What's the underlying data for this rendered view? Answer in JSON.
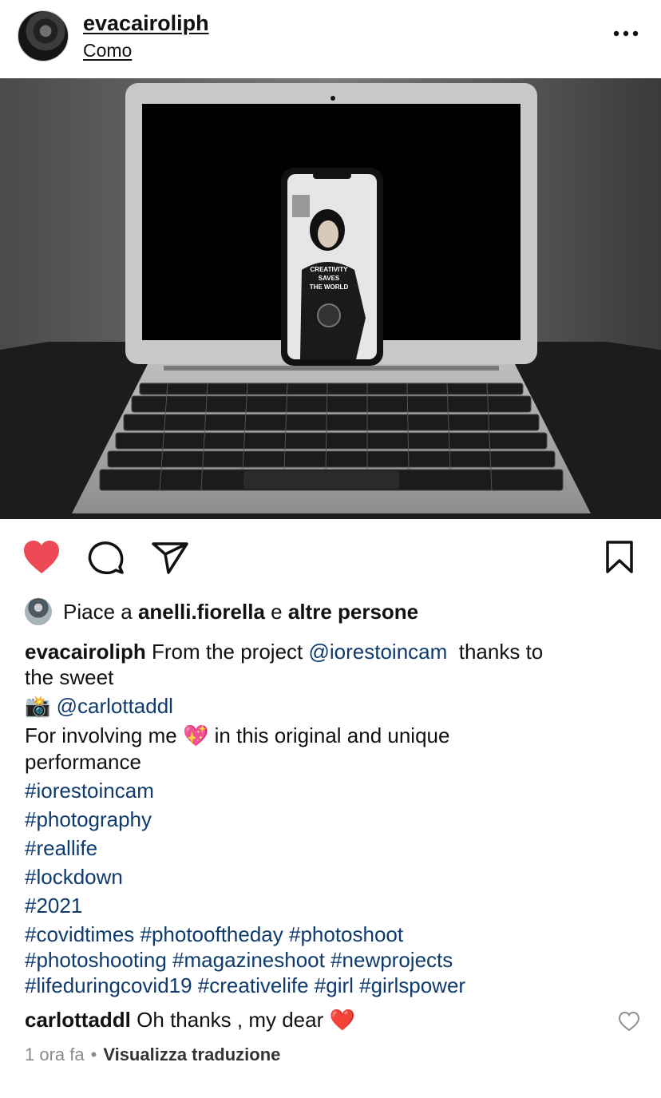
{
  "header": {
    "username": "evacairoliph",
    "location": "Como"
  },
  "photo": {
    "shirt_text": [
      "CREATIVITY",
      "SAVES",
      "THE WORLD"
    ]
  },
  "actions": {
    "liked": true,
    "like_color": "#ed4956"
  },
  "likes": {
    "prefix": "Piace a",
    "user": "anelli.fiorella",
    "conj": "e",
    "others": "altre persone"
  },
  "caption": {
    "author": "evacairoliph",
    "text1": "From the project",
    "mention1": "@iorestoincam",
    "text2": "thanks to",
    "line2": "the sweet",
    "camera_emoji": "📸",
    "mention2": "@carlottaddl",
    "line4a": "For involving me",
    "heart_emoji": "💖",
    "line4b": "in this original and unique",
    "line5": "performance",
    "hashtags": [
      "#iorestoincam",
      "#photography",
      "#reallife",
      "#lockdown",
      "#2021",
      "#covidtimes #photooftheday #photoshoot",
      "#photoshooting #magazineshoot #newprojects",
      "#lifeduringcovid19 #creativelife #girl #girlspower"
    ]
  },
  "comment": {
    "user": "carlottaddl",
    "text": "Oh thanks , my dear",
    "emoji": "❤️",
    "time": "1 ora fa",
    "separator": "•",
    "translate": "Visualizza traduzione"
  }
}
